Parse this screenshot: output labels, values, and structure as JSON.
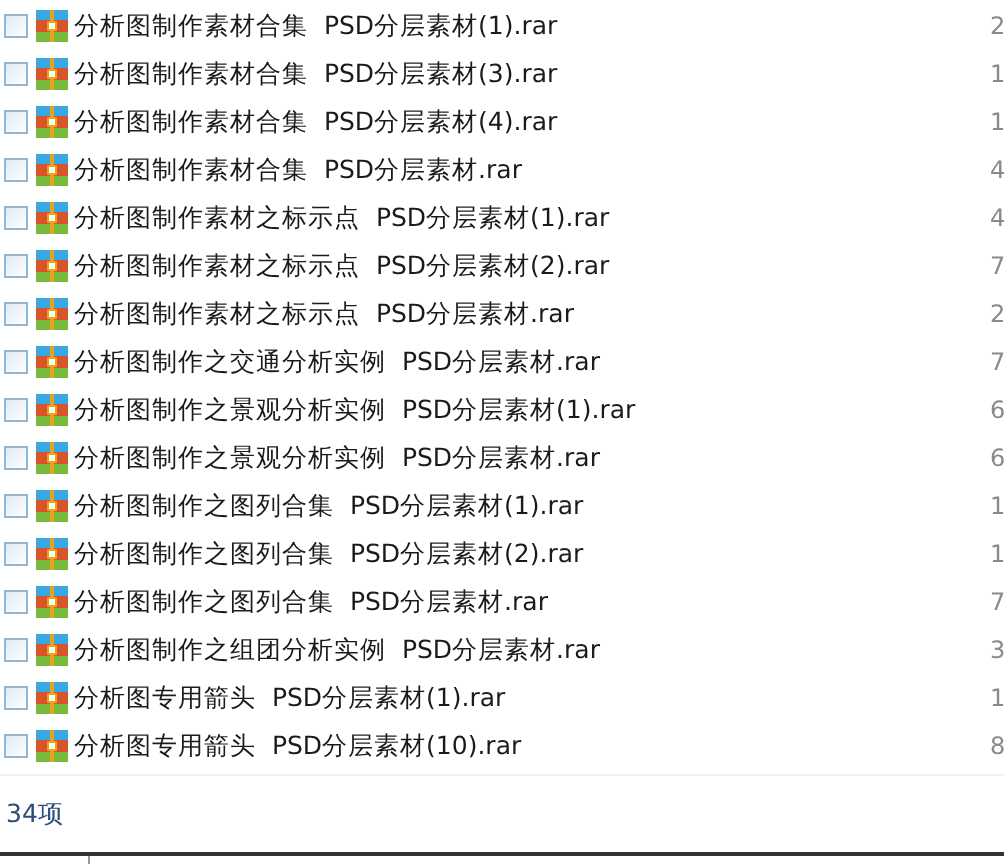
{
  "files": [
    {
      "name": "分析图制作素材合集  PSD分层素材(1).rar",
      "checked": false,
      "column_2": "2"
    },
    {
      "name": "分析图制作素材合集  PSD分层素材(3).rar",
      "checked": false,
      "column_2": "1"
    },
    {
      "name": "分析图制作素材合集  PSD分层素材(4).rar",
      "checked": false,
      "column_2": "1"
    },
    {
      "name": "分析图制作素材合集  PSD分层素材.rar",
      "checked": false,
      "column_2": "4"
    },
    {
      "name": "分析图制作素材之标示点  PSD分层素材(1).rar",
      "checked": false,
      "column_2": "4"
    },
    {
      "name": "分析图制作素材之标示点  PSD分层素材(2).rar",
      "checked": false,
      "column_2": "7"
    },
    {
      "name": "分析图制作素材之标示点  PSD分层素材.rar",
      "checked": false,
      "column_2": "2"
    },
    {
      "name": "分析图制作之交通分析实例  PSD分层素材.rar",
      "checked": false,
      "column_2": "7"
    },
    {
      "name": "分析图制作之景观分析实例  PSD分层素材(1).rar",
      "checked": false,
      "column_2": "6"
    },
    {
      "name": "分析图制作之景观分析实例  PSD分层素材.rar",
      "checked": false,
      "column_2": "6"
    },
    {
      "name": "分析图制作之图列合集  PSD分层素材(1).rar",
      "checked": false,
      "column_2": "1"
    },
    {
      "name": "分析图制作之图列合集  PSD分层素材(2).rar",
      "checked": false,
      "column_2": "1"
    },
    {
      "name": "分析图制作之图列合集  PSD分层素材.rar",
      "checked": false,
      "column_2": "7"
    },
    {
      "name": "分析图制作之组团分析实例  PSD分层素材.rar",
      "checked": false,
      "column_2": "3"
    },
    {
      "name": "分析图专用箭头  PSD分层素材(1).rar",
      "checked": false,
      "column_2": "1"
    },
    {
      "name": "分析图专用箭头  PSD分层素材(10).rar",
      "checked": false,
      "column_2": "8"
    }
  ],
  "status_bar": {
    "item_count": "34项"
  }
}
